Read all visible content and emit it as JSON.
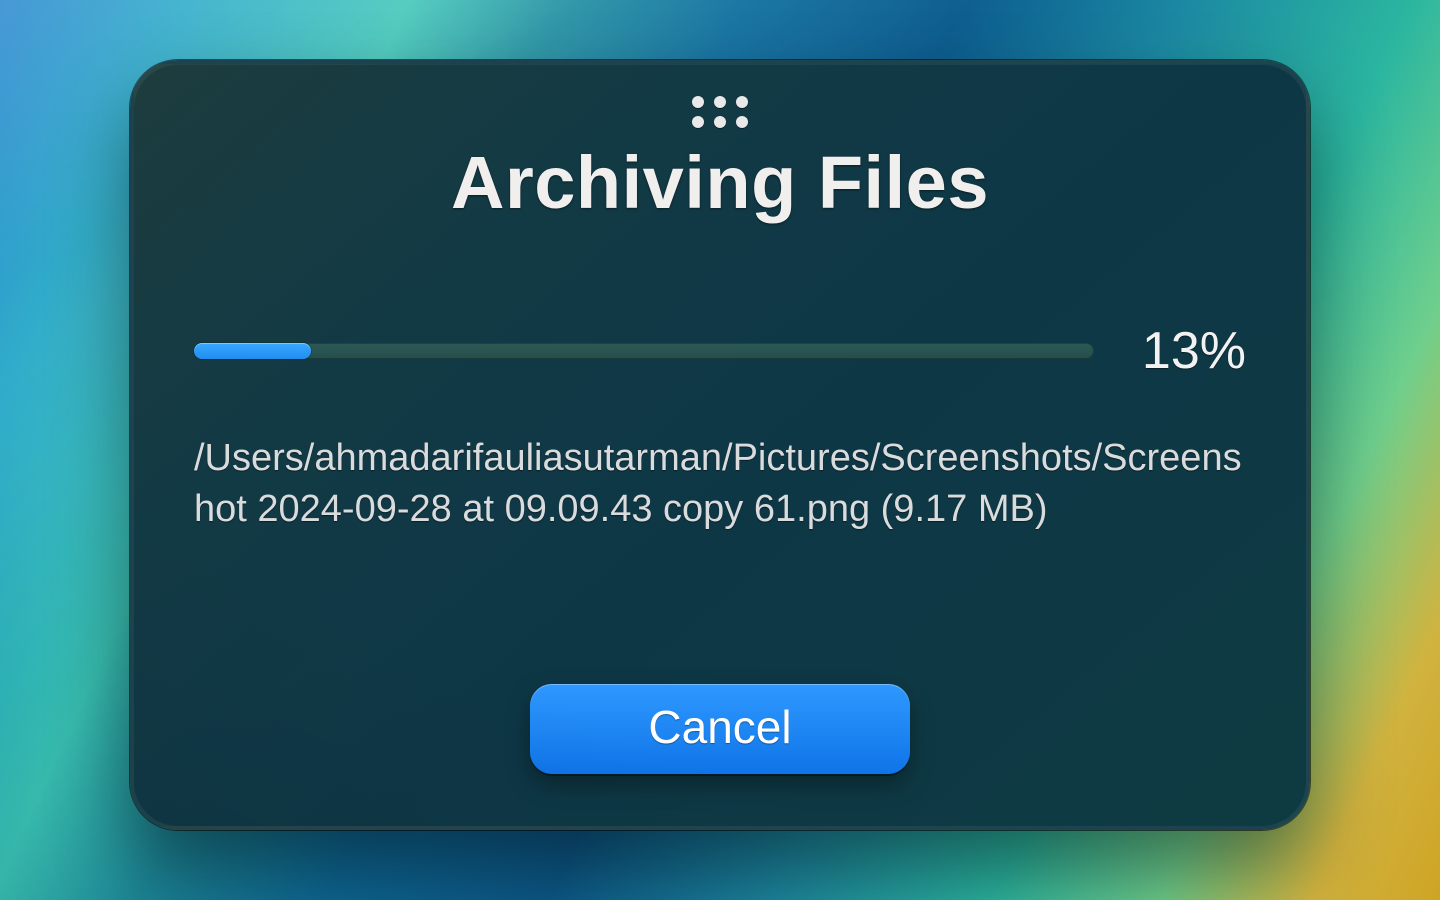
{
  "dialog": {
    "title": "Archiving Files",
    "progress_percent_label": "13%",
    "progress_percent_value": 13,
    "current_item_text": "/Users/ahmadarifauliasutarman/Pictures/Screenshots/Screenshot 2024-09-28 at 09.09.43 copy 61.png (9.17 MB)",
    "cancel_label": "Cancel"
  },
  "colors": {
    "accent_blue": "#1f8df0",
    "track": "#2e5a56",
    "panel_bg": "#123a45"
  }
}
